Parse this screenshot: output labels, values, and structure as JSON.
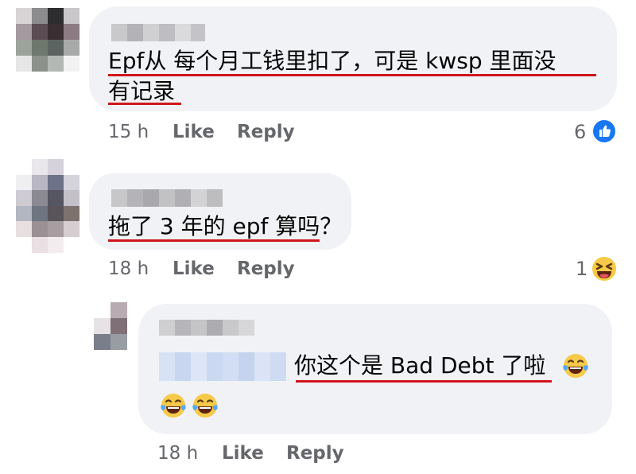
{
  "comments": [
    {
      "text_line1": "Epf从 每个月工钱里扣了，可是 kwsp 里面没",
      "text_line2": "有记录",
      "time": "15 h",
      "like_label": "Like",
      "reply_label": "Reply",
      "reaction_count": "6",
      "reaction_icon": "thumbs-up-icon"
    },
    {
      "text": "拖了 3 年的 epf 算吗？",
      "time": "18 h",
      "like_label": "Like",
      "reply_label": "Reply",
      "reaction_count": "1",
      "reaction_icon": "laughing-emoji-icon"
    }
  ],
  "reply": {
    "text": "你这个是 Bad Debt 了啦",
    "time": "18 h",
    "like_label": "Like",
    "reply_label": "Reply",
    "inline_emoji": "tears-of-joy-emoji",
    "emoji_count": 3
  },
  "colors": {
    "bubble_bg": "#f0f2f5",
    "underline": "#d0151c",
    "meta_text": "#65676b",
    "like_blue": "#1877f2",
    "emoji_yellow": "#f7c948"
  }
}
